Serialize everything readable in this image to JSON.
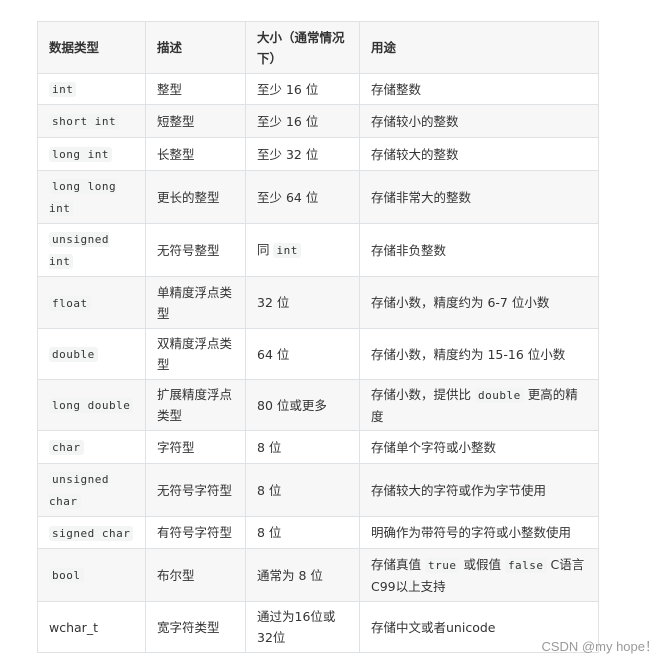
{
  "table": {
    "headers": [
      "数据类型",
      "描述",
      "大小（通常情况下）",
      "用途"
    ],
    "rows": [
      {
        "type": [
          {
            "code": "int"
          }
        ],
        "desc": "整型",
        "size": [
          {
            "text": "至少 16 位"
          }
        ],
        "usage": [
          {
            "text": "存储整数"
          }
        ],
        "height": 31
      },
      {
        "type": [
          {
            "code": "short int"
          }
        ],
        "desc": "短整型",
        "size": [
          {
            "text": "至少 16 位"
          }
        ],
        "usage": [
          {
            "text": "存储较小的整数"
          }
        ],
        "height": 33
      },
      {
        "type": [
          {
            "code": "long int"
          }
        ],
        "desc": "长整型",
        "size": [
          {
            "text": "至少 32 位"
          }
        ],
        "usage": [
          {
            "text": "存储较大的整数"
          }
        ],
        "height": 33
      },
      {
        "type": [
          {
            "code": "long long int"
          }
        ],
        "desc": "更长的整型",
        "size": [
          {
            "text": "至少 64 位"
          }
        ],
        "usage": [
          {
            "text": "存储非常大的整数"
          }
        ],
        "height": 53
      },
      {
        "type": [
          {
            "code": "unsigned int"
          }
        ],
        "desc": "无符号整型",
        "size": [
          {
            "text": "同 "
          },
          {
            "code": "int"
          }
        ],
        "usage": [
          {
            "text": "存储非负整数"
          }
        ],
        "height": 53
      },
      {
        "type": [
          {
            "code": "float"
          }
        ],
        "desc": "单精度浮点类型",
        "size": [
          {
            "text": "32 位"
          }
        ],
        "usage": [
          {
            "text": "存储小数，精度约为 6-7 位小数"
          }
        ],
        "height": 52
      },
      {
        "type": [
          {
            "code": "double"
          }
        ],
        "desc": "双精度浮点类型",
        "size": [
          {
            "text": "64 位"
          }
        ],
        "usage": [
          {
            "text": "存储小数，精度约为 15-16 位小数"
          }
        ],
        "height": 51
      },
      {
        "type": [
          {
            "code": "long double"
          }
        ],
        "desc": "扩展精度浮点类型",
        "size": [
          {
            "text": "80 位或更多"
          }
        ],
        "usage": [
          {
            "text": "存储小数，提供比 "
          },
          {
            "code": "double"
          },
          {
            "text": " 更高的精度"
          }
        ],
        "height": 51
      },
      {
        "type": [
          {
            "code": "char"
          }
        ],
        "desc": "字符型",
        "size": [
          {
            "text": "8 位"
          }
        ],
        "usage": [
          {
            "text": "存储单个字符或小整数"
          }
        ],
        "height": 33
      },
      {
        "type": [
          {
            "code": "unsigned char"
          }
        ],
        "desc": "无符号字符型",
        "size": [
          {
            "text": "8 位"
          }
        ],
        "usage": [
          {
            "text": "存储较大的字符或作为字节使用"
          }
        ],
        "height": 53
      },
      {
        "type": [
          {
            "code": "signed char"
          }
        ],
        "desc": "有符号字符型",
        "size": [
          {
            "text": "8 位"
          }
        ],
        "usage": [
          {
            "text": "明确作为带符号的字符或小整数使用"
          }
        ],
        "height": 32
      },
      {
        "type": [
          {
            "code": "bool"
          }
        ],
        "desc": "布尔型",
        "size": [
          {
            "text": "通常为 8 位"
          }
        ],
        "usage": [
          {
            "text": "存储真值 "
          },
          {
            "code": "true"
          },
          {
            "text": " 或假值 "
          },
          {
            "code": "false"
          },
          {
            "text": " C语言C99以上支持"
          }
        ],
        "height": 53
      },
      {
        "type": [
          {
            "text": "wchar_t"
          }
        ],
        "desc": "宽字符类型",
        "size": [
          {
            "text": "通过为16位或32位"
          }
        ],
        "usage": [
          {
            "text": "存储中文或者unicode"
          }
        ],
        "height": 51
      }
    ]
  },
  "watermark": "CSDN @my hope！"
}
